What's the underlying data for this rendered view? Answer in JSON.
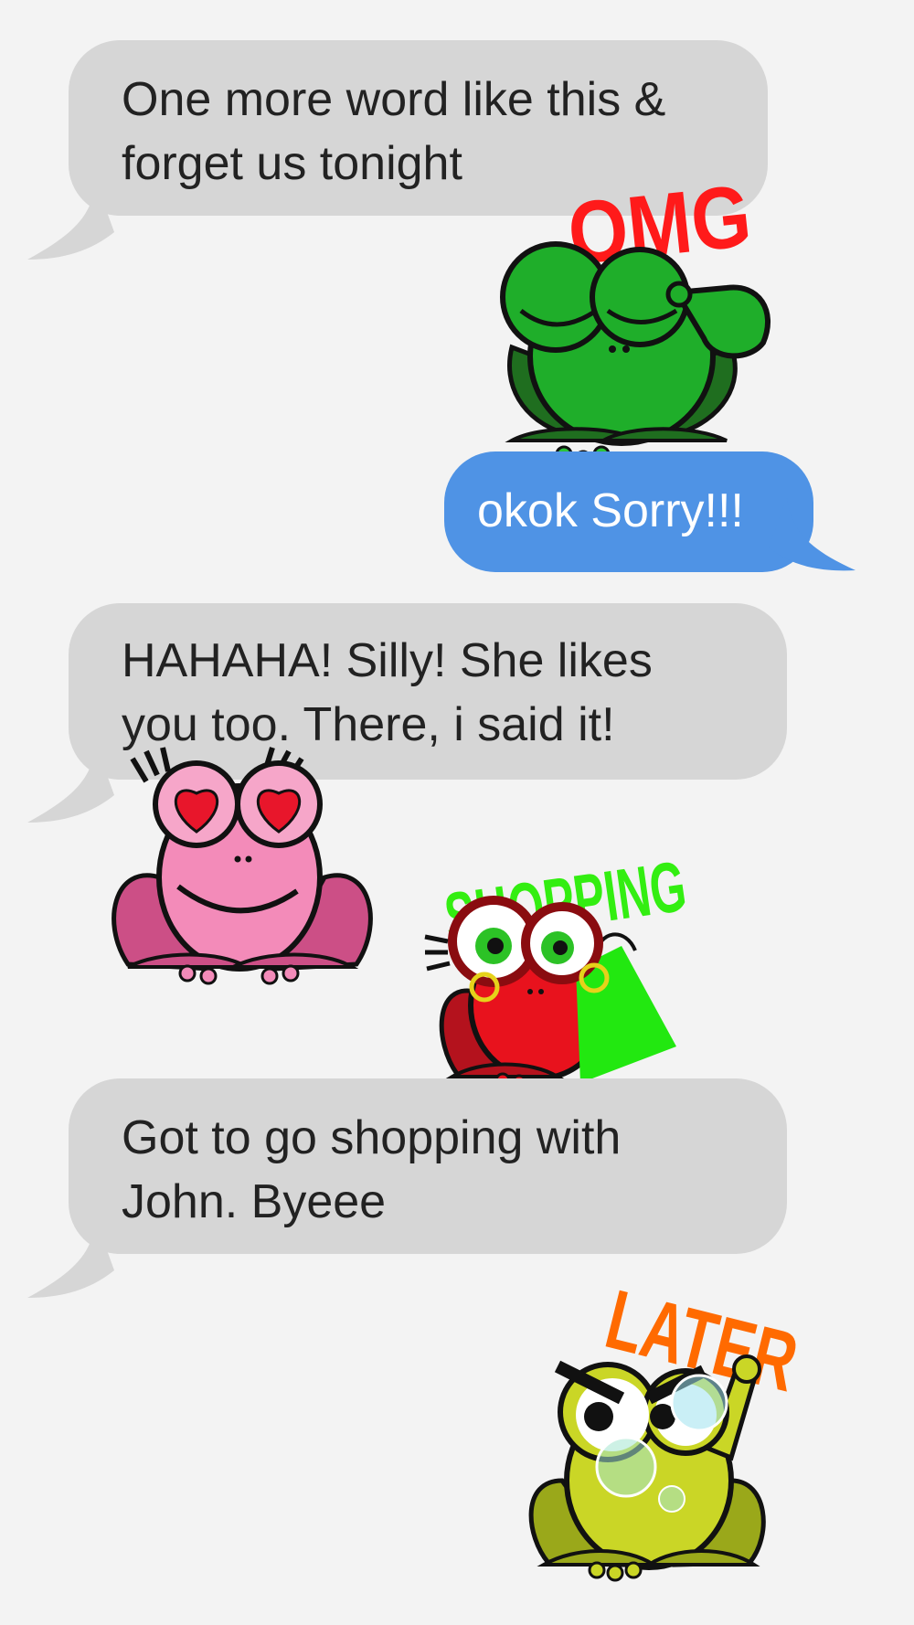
{
  "conversation": {
    "messages": [
      {
        "direction": "incoming",
        "text": "One more word like this &\nforget us tonight"
      },
      {
        "direction": "outgoing",
        "text": "okok Sorry!!!"
      },
      {
        "direction": "incoming",
        "text": "HAHAHA! Silly! She likes\nyou too. There, i said it!"
      },
      {
        "direction": "incoming",
        "text": "Got to go shopping with\nJohn. Byeee"
      }
    ],
    "stickers": [
      {
        "word": "OMG",
        "icon": "green-frog-omg-sticker-icon",
        "word_color": "#ff1a1a"
      },
      {
        "word": "",
        "icon": "pink-frog-heart-eyes-sticker-icon"
      },
      {
        "word": "SHOPPING",
        "icon": "red-frog-shopping-sticker-icon",
        "word_color": "#33ee11"
      },
      {
        "word": "LATER",
        "icon": "yellow-frog-later-sticker-icon",
        "word_color": "#ff6a00"
      }
    ]
  },
  "colors": {
    "background": "#f3f3f3",
    "incoming_bubble": "#d6d6d6",
    "outgoing_bubble": "#4f93e5"
  }
}
